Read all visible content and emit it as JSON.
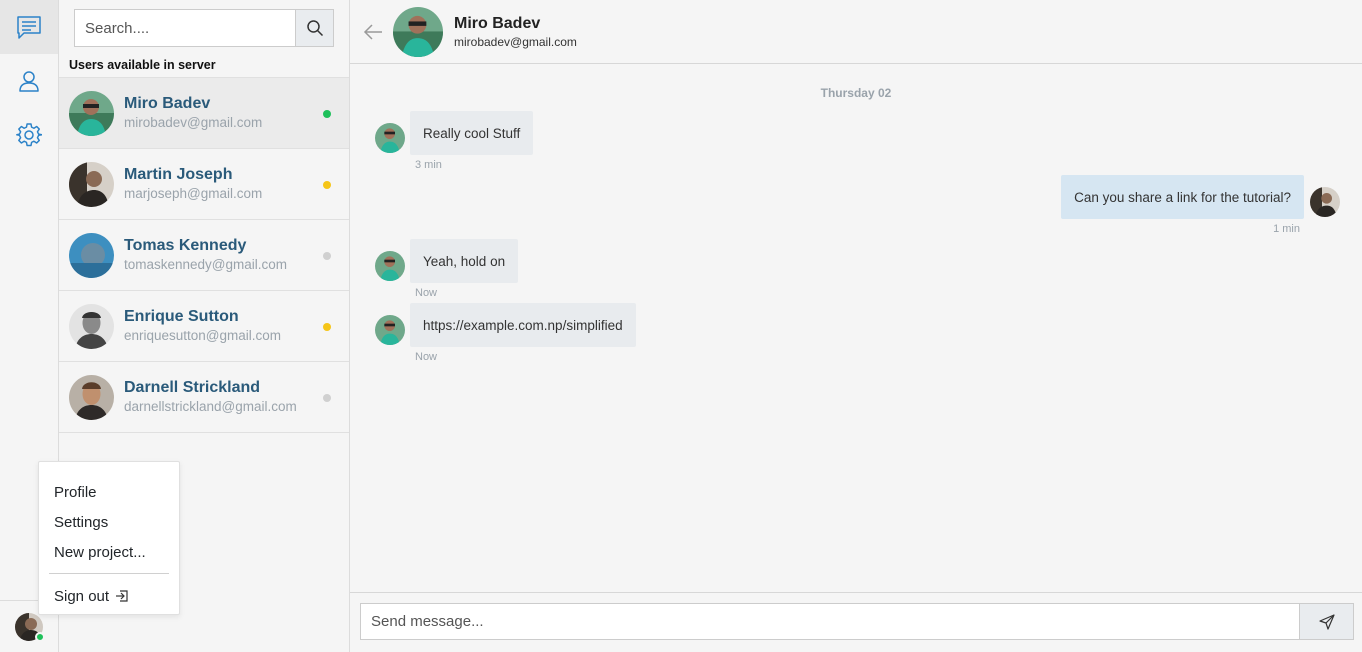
{
  "colors": {
    "accent": "#2b82c8",
    "online": "#1ec05a",
    "away": "#f5c518",
    "offline": "#d0d0d0",
    "name_text": "#2a5a7a",
    "outgoing_bubble": "#d6e6f2",
    "incoming_bubble": "#e8ebee"
  },
  "rail": {
    "icons": [
      "chat-icon",
      "user-icon",
      "gear-icon"
    ],
    "current_user_status": "online"
  },
  "menu": {
    "items": [
      {
        "label": "Profile"
      },
      {
        "label": "Settings"
      },
      {
        "label": "New project..."
      }
    ],
    "signout_label": "Sign out"
  },
  "users_panel": {
    "search_placeholder": "Search....",
    "heading": "Users available in server",
    "users": [
      {
        "name": "Miro Badev",
        "email": "mirobadev@gmail.com",
        "status": "online"
      },
      {
        "name": "Martin Joseph",
        "email": "marjoseph@gmail.com",
        "status": "away"
      },
      {
        "name": "Tomas Kennedy",
        "email": "tomaskennedy@gmail.com",
        "status": "offline"
      },
      {
        "name": "Enrique Sutton",
        "email": "enriquesutton@gmail.com",
        "status": "away"
      },
      {
        "name": "Darnell Strickland",
        "email": "darnellstrickland@gmail.com",
        "status": "offline"
      }
    ]
  },
  "chat": {
    "contact_name": "Miro Badev",
    "contact_email": "mirobadev@gmail.com",
    "day_label": "Thursday 02",
    "messages": [
      {
        "direction": "in",
        "text": "Really cool Stuff",
        "time": "3 min"
      },
      {
        "direction": "out",
        "text": "Can you share a link for the tutorial?",
        "time": "1 min"
      },
      {
        "direction": "in",
        "text": "Yeah, hold on",
        "time": "Now"
      },
      {
        "direction": "in",
        "text": "https://example.com.np/simplified",
        "time": "Now"
      }
    ],
    "composer_placeholder": "Send message..."
  }
}
